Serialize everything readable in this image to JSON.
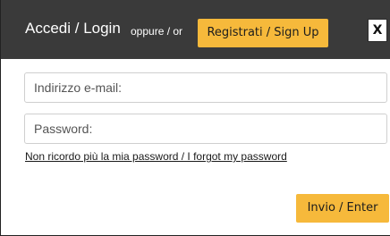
{
  "header": {
    "title": "Accedi / Login",
    "or_text": "oppure / or",
    "signup_label": "Registrati / Sign Up",
    "close_label": "X"
  },
  "form": {
    "email_placeholder": "Indirizzo e-mail:",
    "email_value": "",
    "password_placeholder": "Password:",
    "password_value": "",
    "forgot_link": "Non ricordo più la mia password / I forgot my password",
    "submit_label": "Invio / Enter"
  },
  "colors": {
    "header_bg": "#3a3a3a",
    "accent": "#f6b93b"
  }
}
